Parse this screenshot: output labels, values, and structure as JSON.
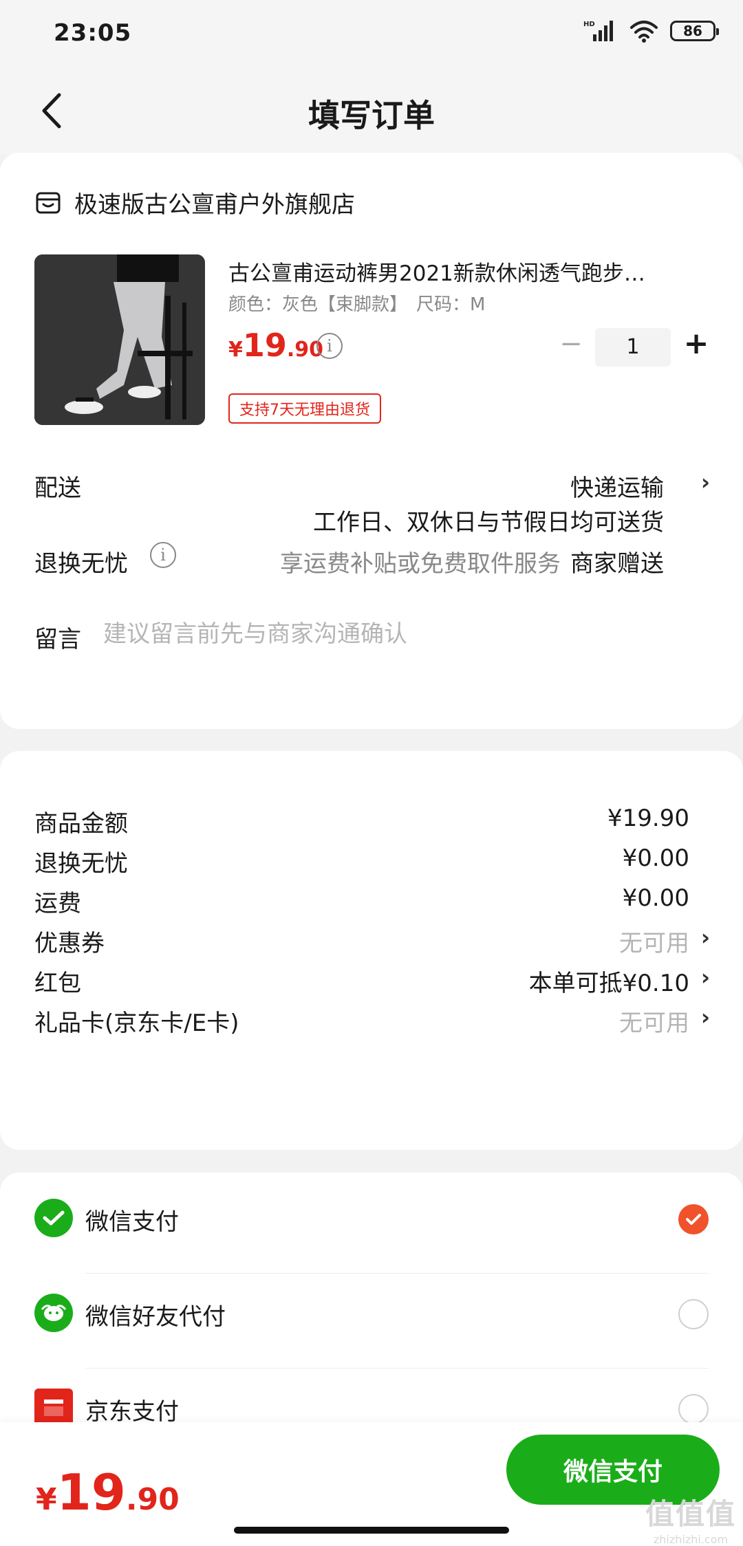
{
  "status": {
    "time": "23:05",
    "network": "HD",
    "battery": "86"
  },
  "nav": {
    "title": "填写订单"
  },
  "shop": {
    "name": "极速版古公亶甫户外旗舰店"
  },
  "product": {
    "title": "古公亶甫运动裤男2021新款休闲透气跑步…",
    "spec": "颜色：灰色【束脚款】　尺码：M",
    "price_yen": "¥",
    "price_int": "19",
    "price_dec": ".90",
    "quantity": "1",
    "qty_minus": "−",
    "qty_plus": "+",
    "return_tag": "支持7天无理由退货"
  },
  "delivery": {
    "label": "配送",
    "method": "快递运输",
    "note": "工作日、双休日与节假日均可送货"
  },
  "returns": {
    "label": "退换无忧",
    "desc": "享运费补贴或免费取件服务",
    "gift": "商家赠送"
  },
  "message": {
    "label": "留言",
    "placeholder": "建议留言前先与商家沟通确认"
  },
  "summary": [
    {
      "label": "商品金额",
      "value": "¥19.90",
      "muted": false,
      "arrow": false
    },
    {
      "label": "退换无忧",
      "value": "¥0.00",
      "muted": false,
      "arrow": false
    },
    {
      "label": "运费",
      "value": "¥0.00",
      "muted": false,
      "arrow": false
    },
    {
      "label": "优惠券",
      "value": "无可用",
      "muted": true,
      "arrow": true
    },
    {
      "label": "红包",
      "value": "本单可抵¥0.10",
      "muted": false,
      "arrow": true
    },
    {
      "label": "礼品卡(京东卡/E卡)",
      "value": "无可用",
      "muted": true,
      "arrow": true
    }
  ],
  "payments": [
    {
      "name": "微信支付",
      "icon": "wechat-pay-icon",
      "selected": true
    },
    {
      "name": "微信好友代付",
      "icon": "wechat-friend-pay-icon",
      "selected": false
    },
    {
      "name": "京东支付",
      "icon": "jd-pay-icon",
      "selected": false
    }
  ],
  "bottom": {
    "total_yen": "¥",
    "total_int": "19",
    "total_dec": ".90",
    "pay_button": "微信支付"
  },
  "watermark": {
    "big": "值值值",
    "small": "zhizhizhi.com"
  },
  "colors": {
    "price_red": "#e1251b",
    "wechat_green": "#1aad19",
    "check_orange": "#f0522c"
  }
}
